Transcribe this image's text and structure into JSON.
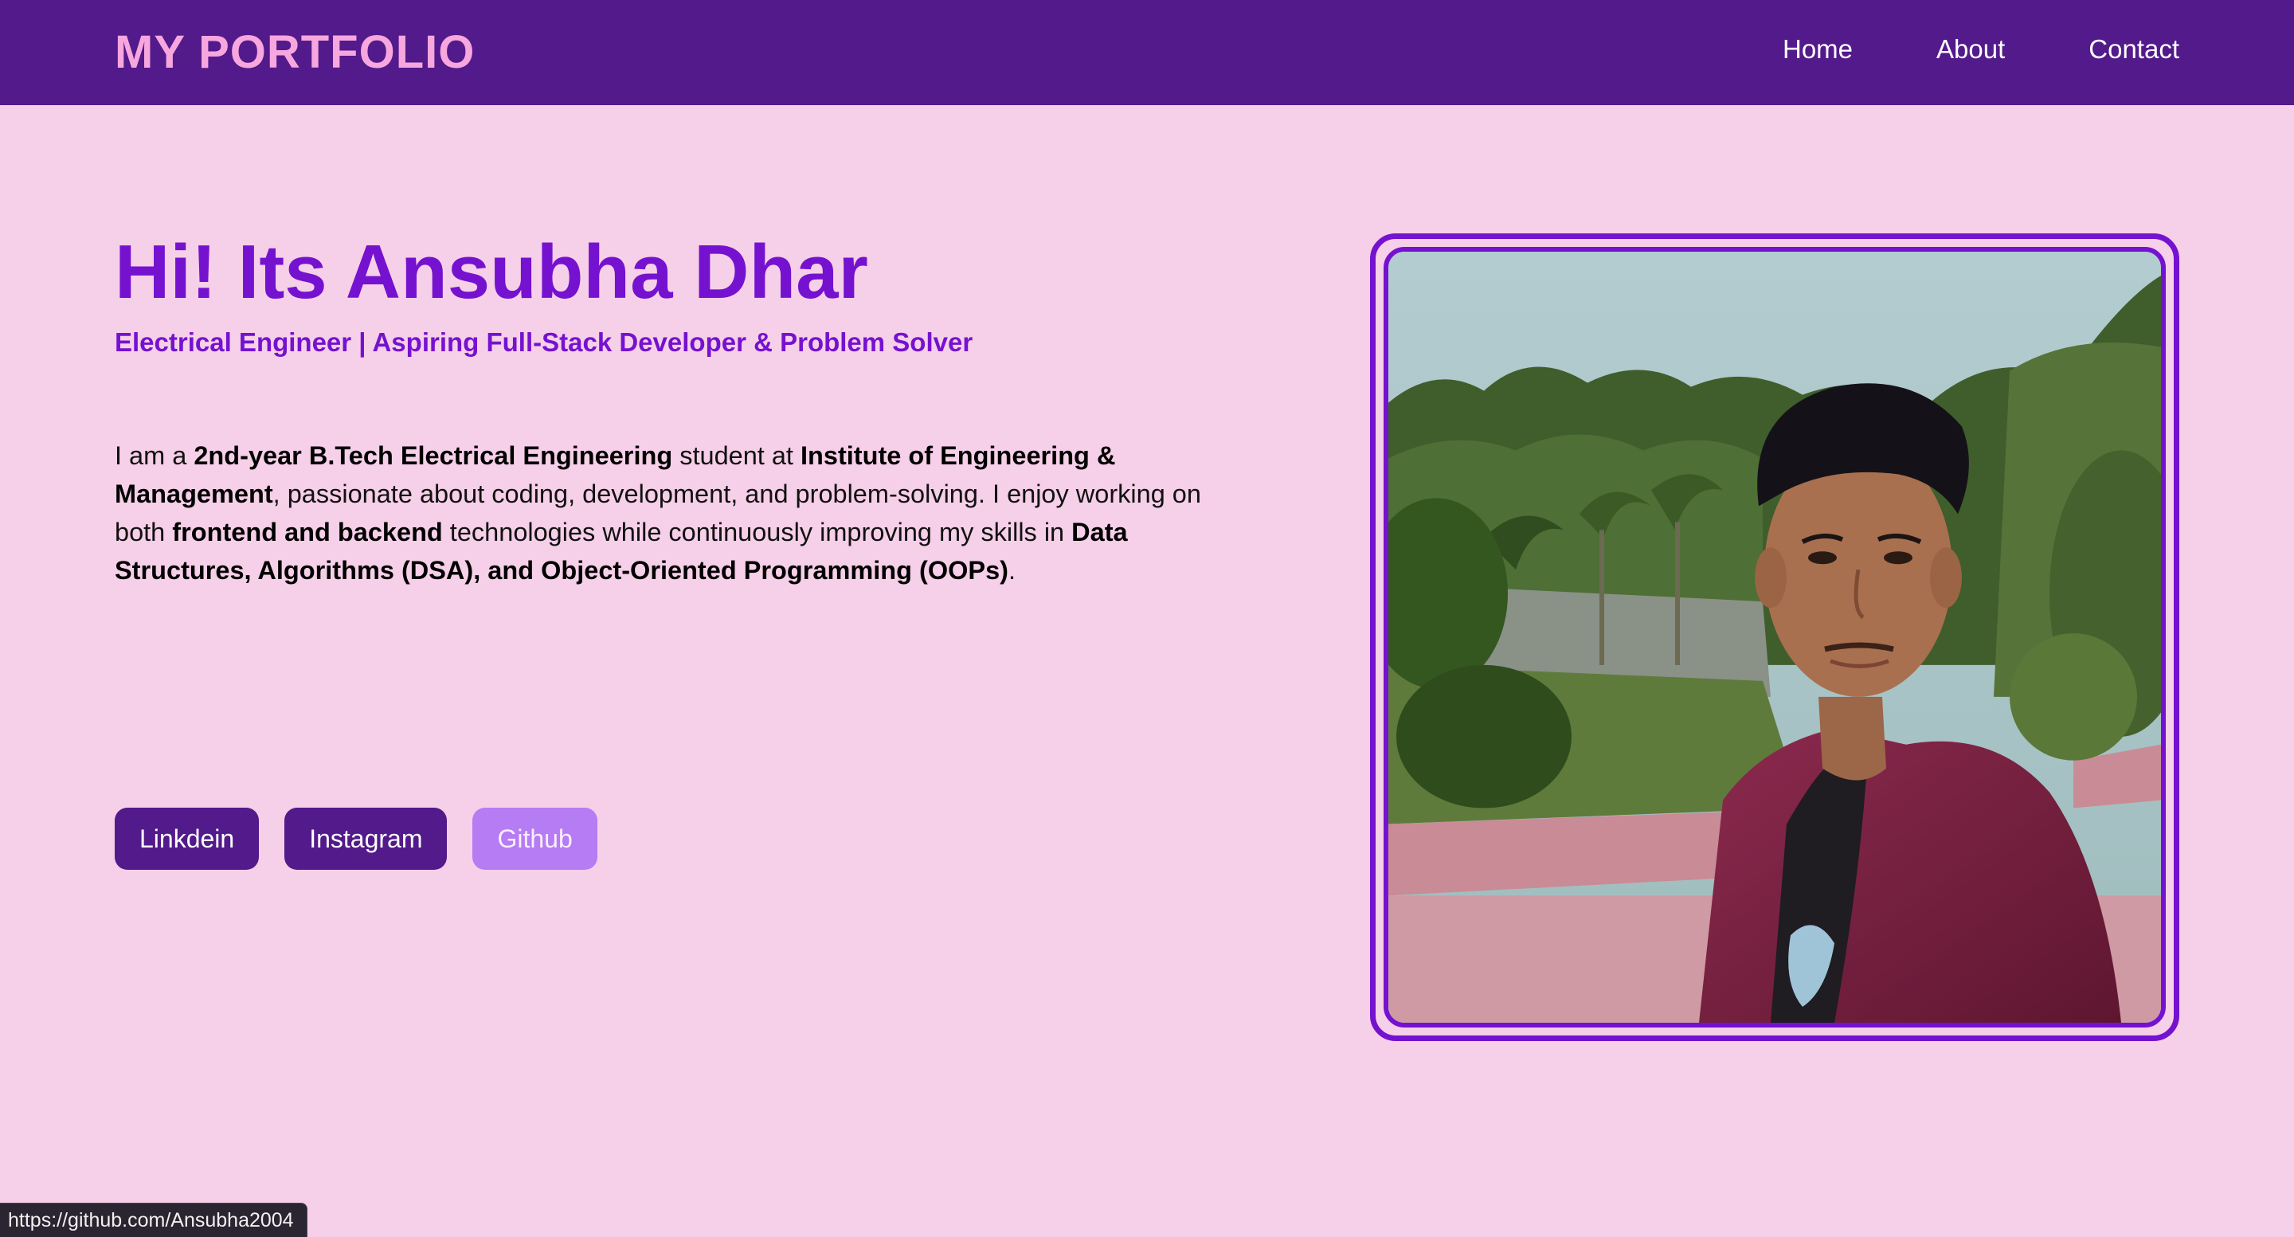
{
  "brand": "MY PORTFOLIO",
  "nav": {
    "items": [
      {
        "label": "Home"
      },
      {
        "label": "About"
      },
      {
        "label": "Contact"
      }
    ]
  },
  "hero": {
    "title": "Hi! Its Ansubha Dhar",
    "subtitle": "Electrical Engineer | Aspiring Full-Stack Developer & Problem Solver",
    "bio": {
      "t1": "I am a ",
      "b1": "2nd-year B.Tech Electrical Engineering",
      "t2": " student at ",
      "b2": "Institute of Engineering & Management",
      "t3": ", passionate about coding, development, and problem-solving. I enjoy working on both ",
      "b3": "frontend and backend",
      "t4": " technologies while continuously improving my skills in ",
      "b4": "Data Structures, Algorithms (DSA), and Object-Oriented Programming (OOPs)",
      "t5": "."
    }
  },
  "social": {
    "linkedin": "Linkdein",
    "instagram": "Instagram",
    "github": "Github"
  },
  "status_bar": {
    "url": "https://github.com/Ansubha2004"
  },
  "colors": {
    "background": "#f6cfe8",
    "navbar": "#521a8a",
    "brand": "#f7a6de",
    "accent": "#7512cf",
    "button": "#521a8a",
    "button_hover": "#b57cf3"
  }
}
